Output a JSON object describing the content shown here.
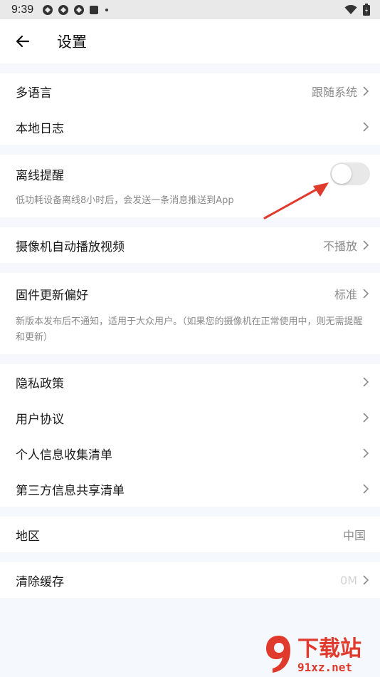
{
  "status_bar": {
    "time": "9:39",
    "notification_icons": [
      "app-notification-icon",
      "app-notification-icon",
      "app-notification-icon",
      "square-notification-icon",
      "dot-icon"
    ],
    "right_icons": [
      "wifi-icon",
      "battery-icon"
    ]
  },
  "header": {
    "title": "设置",
    "back_icon": "arrow-left-icon"
  },
  "groups": {
    "g1": {
      "language": {
        "label": "多语言",
        "value": "跟随系统"
      },
      "local_log": {
        "label": "本地日志"
      }
    },
    "offline": {
      "label": "离线提醒",
      "toggle_on": false,
      "desc": "低功耗设备离线8小时后，会发送一条消息推送到App"
    },
    "autoplay": {
      "label": "摄像机自动播放视频",
      "value": "不播放"
    },
    "firmware": {
      "label": "固件更新偏好",
      "value": "标准",
      "desc": "新版本发布后不通知，适用于大众用户。（如果您的摄像机在正常使用中，则无需提醒和更新）"
    },
    "legal": {
      "privacy": "隐私政策",
      "agreement": "用户协议",
      "personal_info": "个人信息收集清单",
      "third_party": "第三方信息共享清单"
    },
    "region": {
      "label": "地区",
      "value": "中国"
    },
    "cache": {
      "label": "清除缓存",
      "value": "0M"
    }
  },
  "watermark": {
    "text_big": "下载站",
    "text_small": "91xz.net"
  },
  "colors": {
    "accent_red": "#e03a2d",
    "background": "#f5f8fc"
  }
}
